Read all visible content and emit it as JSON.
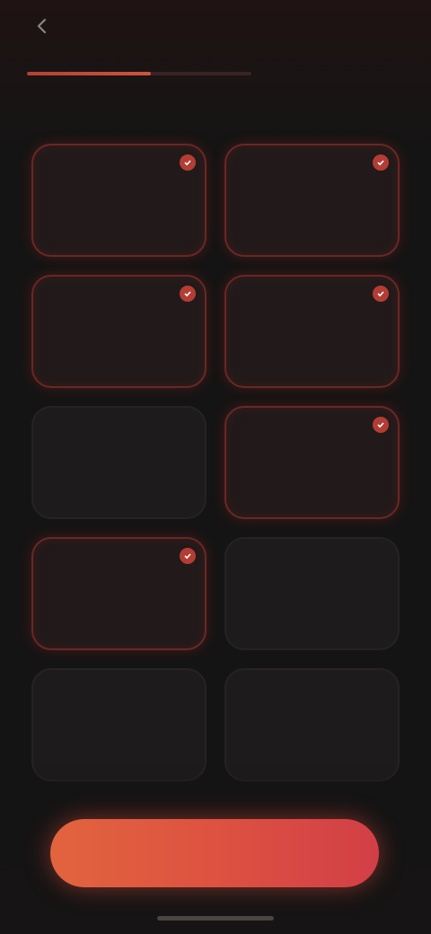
{
  "header": {
    "back_icon": "arrow-left-icon",
    "left_text": "",
    "skip_label": "",
    "step_text": "",
    "progress_fraction": 0.55
  },
  "title": "",
  "options": [
    {
      "label": "",
      "selected": true
    },
    {
      "label": "",
      "selected": true
    },
    {
      "label": "",
      "selected": true
    },
    {
      "label": "",
      "selected": true
    },
    {
      "label": "",
      "selected": false
    },
    {
      "label": "",
      "selected": true
    },
    {
      "label": "",
      "selected": true
    },
    {
      "label": "",
      "selected": false
    },
    {
      "label": "",
      "selected": false
    },
    {
      "label": "",
      "selected": false
    }
  ],
  "cta": {
    "label": ""
  },
  "colors": {
    "accent": "#d2523b",
    "selected_border": "#6b2724",
    "background": "#151414",
    "tile_background": "#1d1b1b"
  }
}
